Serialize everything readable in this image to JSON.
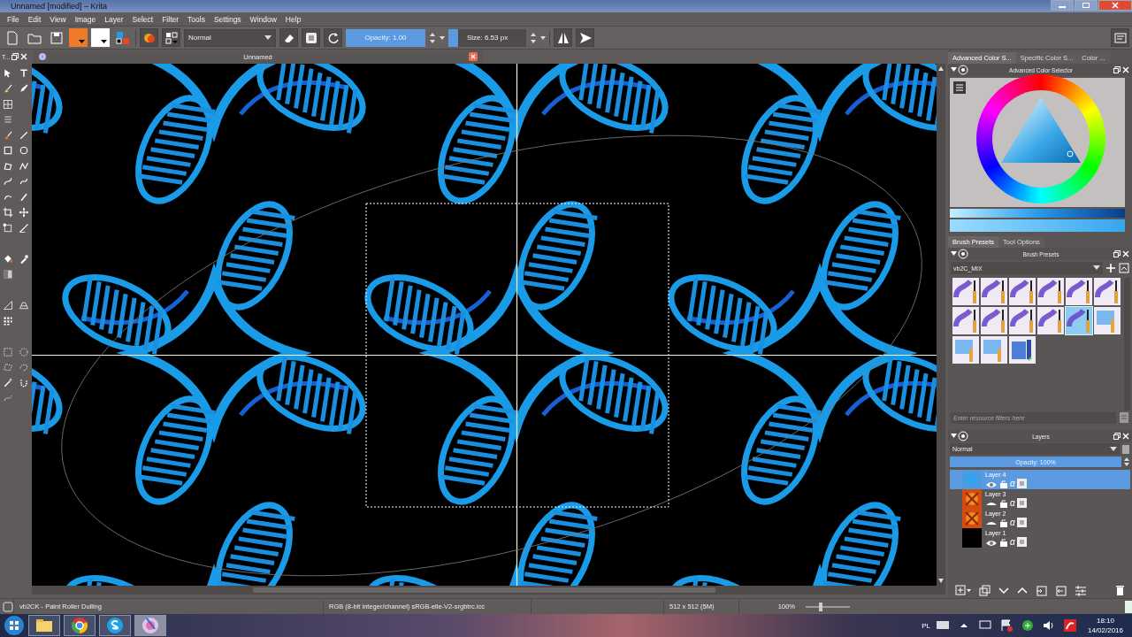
{
  "window": {
    "title": "Unnamed [modified] – Krita"
  },
  "menu": [
    "File",
    "Edit",
    "View",
    "Image",
    "Layer",
    "Select",
    "Filter",
    "Tools",
    "Settings",
    "Window",
    "Help"
  ],
  "toolbar": {
    "blend_mode": "Normal",
    "opacity": {
      "text": "Opacity:  1.00",
      "level": 1
    },
    "size": {
      "text": "Size:  6.53 px",
      "level": 0.12
    }
  },
  "left_docker_tab": "T...",
  "document_tab": "Unnamed",
  "color_docker": {
    "tabs": [
      {
        "label": "Advanced Color S...",
        "selected": true
      },
      {
        "label": "Specific Color S...",
        "selected": false
      },
      {
        "label": "Color ...",
        "selected": false
      }
    ],
    "title": "Advanced Color Selector"
  },
  "brush_docker": {
    "tabs": [
      {
        "label": "Brush Presets",
        "selected": true
      },
      {
        "label": "Tool Options",
        "selected": false
      }
    ],
    "title": "Brush Presets",
    "tag": "vb2C_MIX",
    "presets": [
      {
        "kind": "brush",
        "selected": false
      },
      {
        "kind": "brush",
        "selected": false
      },
      {
        "kind": "brush",
        "selected": false
      },
      {
        "kind": "brush",
        "selected": false
      },
      {
        "kind": "brush",
        "selected": false
      },
      {
        "kind": "brush",
        "selected": false
      },
      {
        "kind": "brush",
        "selected": false
      },
      {
        "kind": "brush",
        "selected": false
      },
      {
        "kind": "brush",
        "selected": false
      },
      {
        "kind": "brush",
        "selected": false
      },
      {
        "kind": "brush",
        "selected": true
      },
      {
        "kind": "pencil",
        "selected": false
      },
      {
        "kind": "pencil",
        "selected": false
      },
      {
        "kind": "pencil",
        "selected": false
      },
      {
        "kind": "roller",
        "selected": false
      }
    ],
    "filter_placeholder": "Enter resource filters here"
  },
  "layers_docker": {
    "title": "Layers",
    "blend_mode": "Normal",
    "opacity": {
      "text": "Opacity:  100%",
      "level": 1
    },
    "layers": [
      {
        "name": "Layer 4",
        "selected": true,
        "visible": true,
        "kind": "sketch",
        "alpha_symbol": "α"
      },
      {
        "name": "Layer 3",
        "selected": false,
        "visible": false,
        "kind": "pattern",
        "alpha_symbol": "α"
      },
      {
        "name": "Layer 2",
        "selected": false,
        "visible": false,
        "kind": "pattern",
        "alpha_symbol": "α"
      },
      {
        "name": "Layer 1",
        "selected": false,
        "visible": true,
        "kind": "fill",
        "alpha_symbol": "α"
      }
    ]
  },
  "status_bar": {
    "brush": "vb2CK - Paint Roller Dulling",
    "color_space": "RGB (8-bit integer/channel)  sRGB-elle-V2-srgbtrc.icc",
    "image_size": "512 x 512 (5M)",
    "zoom": "100%",
    "zoom_slider": {
      "level": 0.3
    }
  },
  "taskbar": {
    "language": "PL",
    "time": "18:10",
    "date": "14/02/2016"
  }
}
